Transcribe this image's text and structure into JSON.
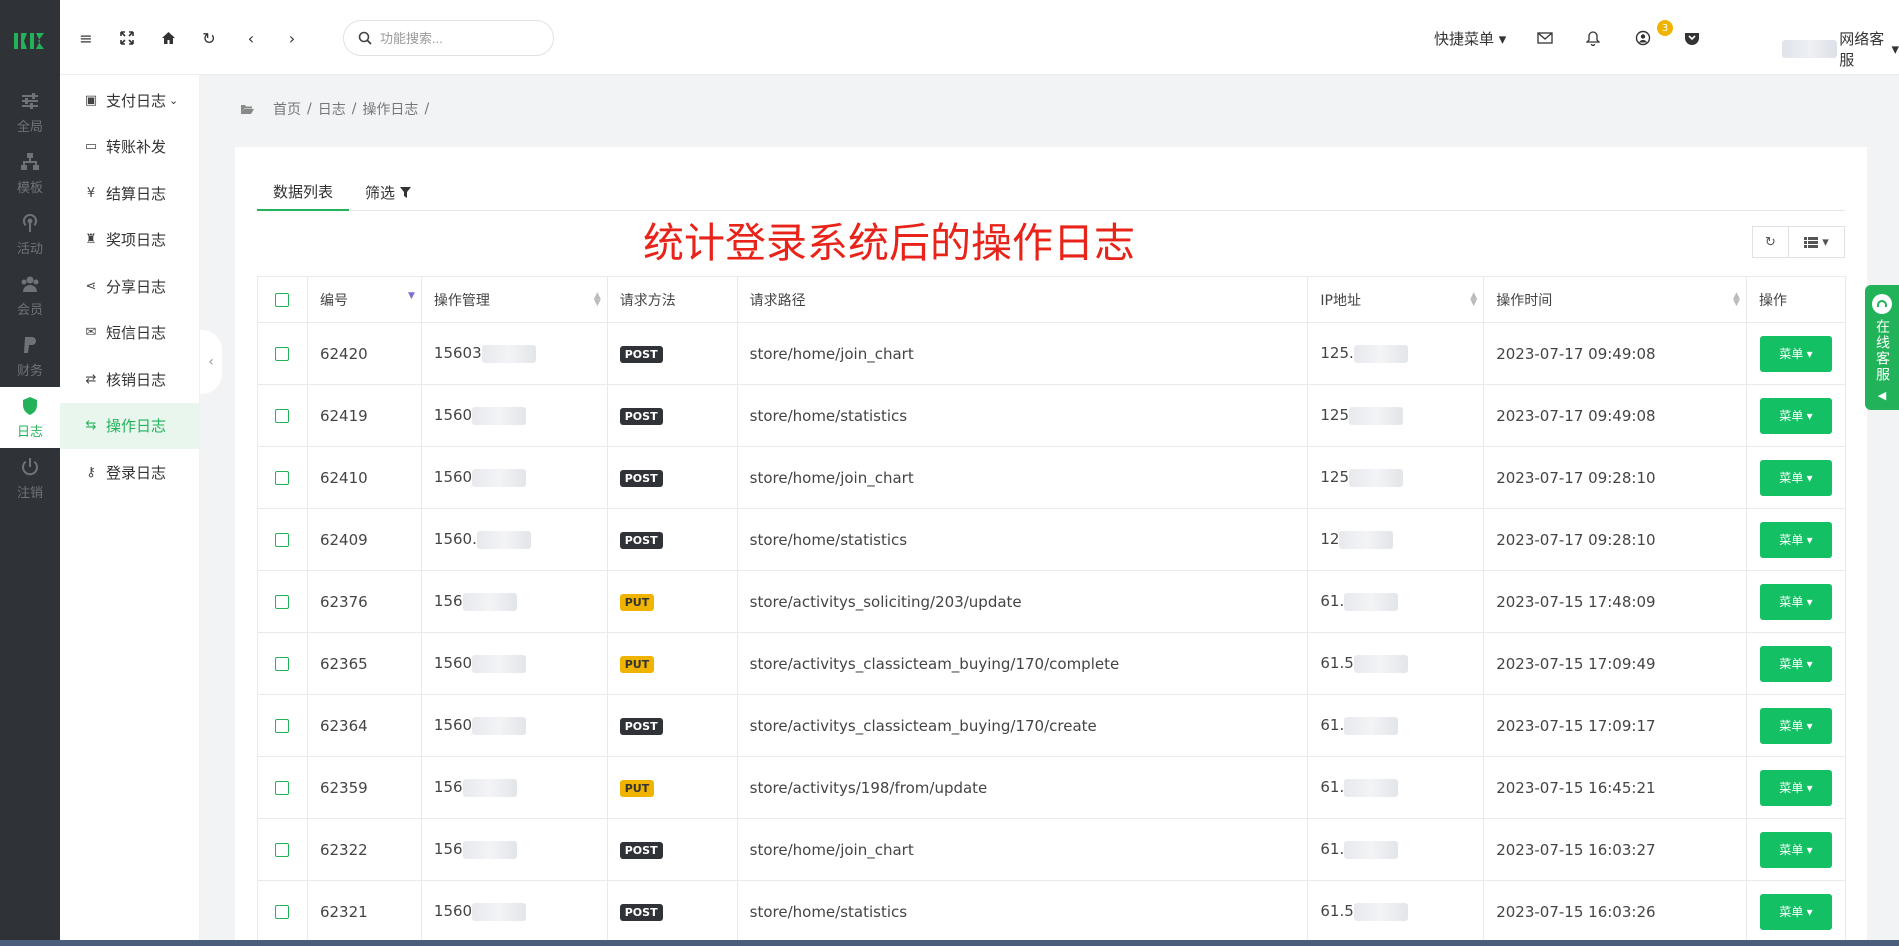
{
  "rail": [
    {
      "label": "全局",
      "icon": "sliders-icon"
    },
    {
      "label": "模板",
      "icon": "sitemap-icon"
    },
    {
      "label": "活动",
      "icon": "broadcast-icon"
    },
    {
      "label": "会员",
      "icon": "users-icon"
    },
    {
      "label": "财务",
      "icon": "paypal-icon"
    },
    {
      "label": "日志",
      "icon": "shield-icon",
      "active": true
    },
    {
      "label": "注销",
      "icon": "power-icon"
    }
  ],
  "subnav": [
    {
      "label": "支付日志",
      "icon": "calendar-check-icon",
      "has_caret": true
    },
    {
      "label": "转账补发",
      "icon": "money-icon"
    },
    {
      "label": "结算日志",
      "icon": "yen-icon"
    },
    {
      "label": "奖项日志",
      "icon": "trophy-icon"
    },
    {
      "label": "分享日志",
      "icon": "share-icon"
    },
    {
      "label": "短信日志",
      "icon": "envelope-icon"
    },
    {
      "label": "核销日志",
      "icon": "retweet-icon"
    },
    {
      "label": "操作日志",
      "icon": "exchange-icon",
      "active": true
    },
    {
      "label": "登录日志",
      "icon": "key-icon"
    }
  ],
  "header": {
    "search_placeholder": "功能搜索...",
    "quick_menu": "快捷菜单",
    "notification_count": "3",
    "username": "网络客服"
  },
  "breadcrumb": [
    "首页",
    "日志",
    "操作日志"
  ],
  "tabs": [
    "数据列表",
    "筛选"
  ],
  "annotation": "统计登录系统后的操作日志",
  "table": {
    "columns": [
      "编号",
      "操作管理",
      "请求方法",
      "请求路径",
      "IP地址",
      "操作时间",
      "操作"
    ],
    "rows": [
      {
        "id": "62420",
        "user": "15603",
        "method": "POST",
        "path": "store/home/join_chart",
        "ip": "125.",
        "time": "2023-07-17 09:49:08"
      },
      {
        "id": "62419",
        "user": "1560",
        "method": "POST",
        "path": "store/home/statistics",
        "ip": "125",
        "time": "2023-07-17 09:49:08"
      },
      {
        "id": "62410",
        "user": "1560",
        "method": "POST",
        "path": "store/home/join_chart",
        "ip": "125",
        "time": "2023-07-17 09:28:10"
      },
      {
        "id": "62409",
        "user": "1560.",
        "method": "POST",
        "path": "store/home/statistics",
        "ip": "12",
        "time": "2023-07-17 09:28:10"
      },
      {
        "id": "62376",
        "user": "156",
        "method": "PUT",
        "path": "store/activitys_soliciting/203/update",
        "ip": "61.",
        "time": "2023-07-15 17:48:09"
      },
      {
        "id": "62365",
        "user": "1560",
        "method": "PUT",
        "path": "store/activitys_classicteam_buying/170/complete",
        "ip": "61.5",
        "time": "2023-07-15 17:09:49"
      },
      {
        "id": "62364",
        "user": "1560",
        "method": "POST",
        "path": "store/activitys_classicteam_buying/170/create",
        "ip": "61.",
        "time": "2023-07-15 17:09:17"
      },
      {
        "id": "62359",
        "user": "156",
        "method": "PUT",
        "path": "store/activitys/198/from/update",
        "ip": "61.",
        "time": "2023-07-15 16:45:21"
      },
      {
        "id": "62322",
        "user": "156",
        "method": "POST",
        "path": "store/home/join_chart",
        "ip": "61.",
        "time": "2023-07-15 16:03:27"
      },
      {
        "id": "62321",
        "user": "1560",
        "method": "POST",
        "path": "store/home/statistics",
        "ip": "61.5",
        "time": "2023-07-15 16:03:26"
      }
    ],
    "action_label": "菜单"
  },
  "online_service": "在线客服",
  "colors": {
    "accent": "#22b35a",
    "rail_bg": "#2f3237",
    "annotation": "#e8231a",
    "put_badge": "#f0b400"
  }
}
